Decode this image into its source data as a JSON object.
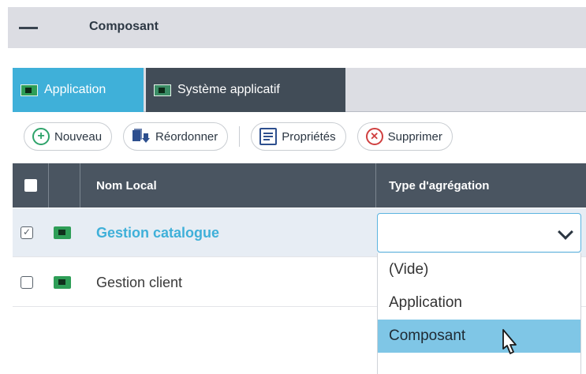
{
  "section": {
    "title": "Composant"
  },
  "tabs": [
    {
      "label": "Application",
      "active": true
    },
    {
      "label": "Système applicatif",
      "active": false
    }
  ],
  "toolbar": {
    "new_label": "Nouveau",
    "reorder_label": "Réordonner",
    "properties_label": "Propriétés",
    "delete_label": "Supprimer"
  },
  "grid": {
    "columns": {
      "name": "Nom Local",
      "type": "Type d'agrégation"
    },
    "rows": [
      {
        "name": "Gestion catalogue",
        "checked": true,
        "selected": true
      },
      {
        "name": "Gestion client",
        "checked": false,
        "selected": false
      }
    ]
  },
  "select": {
    "value": "",
    "options": [
      "(Vide)",
      "Application",
      "Composant"
    ],
    "highlighted": "Composant"
  },
  "colors": {
    "accent": "#3fb0d9",
    "tab_dark": "#414c57",
    "header_bg": "#4a5561",
    "highlight": "#7fc6e6"
  }
}
